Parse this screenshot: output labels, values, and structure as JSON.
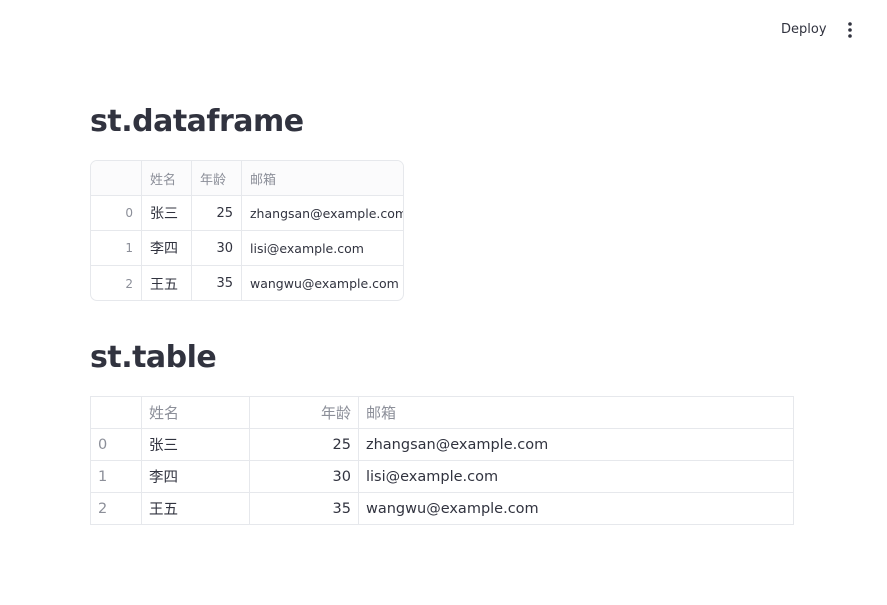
{
  "header": {
    "deploy_label": "Deploy",
    "menu_icon": "more-vertical-icon"
  },
  "sections": {
    "dataframe_title": "st.dataframe",
    "table_title": "st.table"
  },
  "dataframe": {
    "columns": [
      "",
      "姓名",
      "年龄",
      "邮箱"
    ],
    "rows": [
      {
        "index": "0",
        "name": "张三",
        "age": "25",
        "email": "zhangsan@example.com"
      },
      {
        "index": "1",
        "name": "李四",
        "age": "30",
        "email": "lisi@example.com"
      },
      {
        "index": "2",
        "name": "王五",
        "age": "35",
        "email": "wangwu@example.com"
      }
    ]
  },
  "table": {
    "columns": [
      "",
      "姓名",
      "年龄",
      "邮箱"
    ],
    "rows": [
      {
        "index": "0",
        "name": "张三",
        "age": "25",
        "email": "zhangsan@example.com"
      },
      {
        "index": "1",
        "name": "李四",
        "age": "30",
        "email": "lisi@example.com"
      },
      {
        "index": "2",
        "name": "王五",
        "age": "35",
        "email": "wangwu@example.com"
      }
    ]
  }
}
